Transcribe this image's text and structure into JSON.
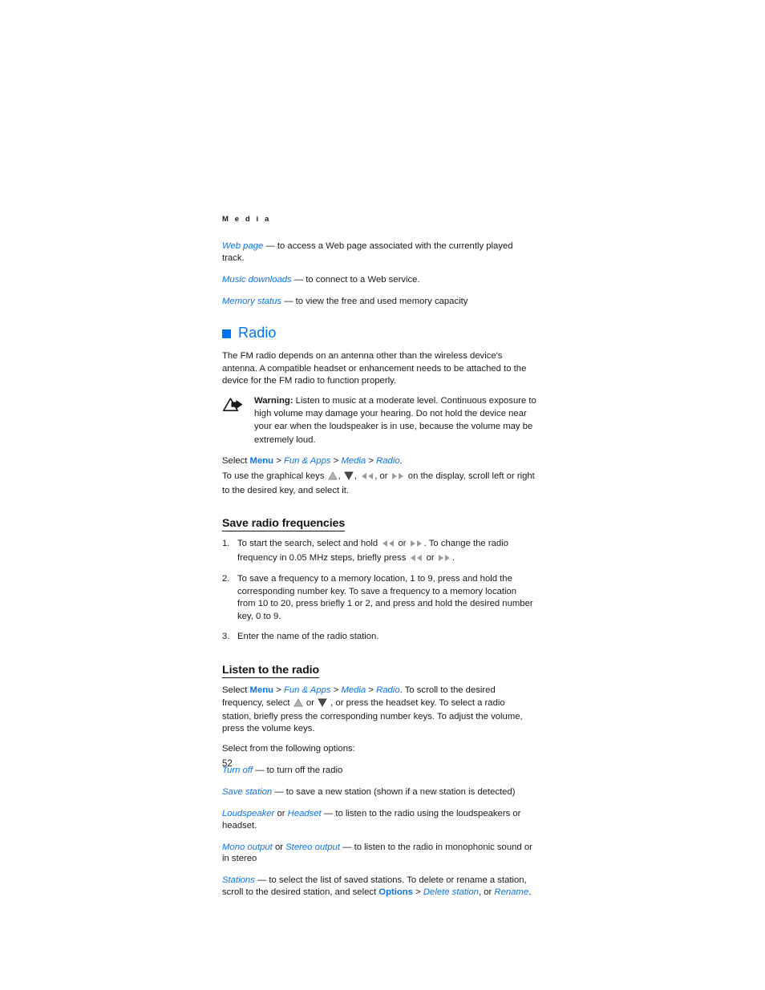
{
  "document": {
    "running_head": "M e d i a",
    "page_number": "52",
    "accent_blue": "#0073f5",
    "link_blue": "#0b72ee",
    "text_color": "#1a1a1a"
  },
  "media_options": [
    {
      "term": "Web page",
      "dash": "—",
      "description": "to access a Web page associated with the currently played track."
    },
    {
      "term": "Music downloads",
      "dash": "—",
      "description": "to connect to a Web service."
    },
    {
      "term": "Memory status",
      "dash": "—",
      "description": "to view the free and used memory capacity"
    }
  ],
  "radio_section": {
    "heading": "Radio",
    "intro": "The FM radio depends on an antenna other than the wireless device's antenna. A compatible headset or enhancement needs to be attached to the device for the FM radio to function properly.",
    "warning": {
      "label": "Warning:",
      "text": "Listen to music at a moderate level. Continuous exposure to high volume may damage your hearing. Do not hold the device near your ear when the loudspeaker is in use, because the volume may be extremely loud.",
      "icon": "warning-triangle-arrow-icon"
    },
    "select_path": {
      "lead": "Select",
      "items": [
        "Menu",
        "Fun & Apps",
        "Media",
        "Radio"
      ],
      "separator": ">",
      "trailing": "."
    },
    "graphical_keys_text": {
      "part1": "To use the graphical keys",
      "part2": ",",
      "part3": ",",
      "part4": ", or",
      "part5": "on the display, scroll left or right to the desired key, and select it.",
      "icons": [
        "scroll-up-icon",
        "scroll-down-icon",
        "rewind-icon",
        "fast-forward-icon"
      ]
    }
  },
  "save_frequencies": {
    "heading": "Save radio frequencies",
    "steps": [
      {
        "number": "1.",
        "part1": "To start the search, select and hold",
        "part2": "or",
        "part3": ". To change the radio frequency in 0.05 MHz steps, briefly press",
        "part4": "or",
        "part5": "."
      },
      {
        "number": "2.",
        "text": "To save a frequency to a memory location, 1 to 9, press and hold the corresponding number key. To save a frequency to a memory location from 10 to 20, press briefly 1 or 2, and press and hold the desired number key, 0 to 9."
      },
      {
        "number": "3.",
        "text": "Enter the name of the radio station."
      }
    ]
  },
  "listen_section": {
    "heading": "Listen to the radio",
    "select_path": {
      "lead": "Select",
      "items": [
        "Menu",
        "Fun & Apps",
        "Media",
        "Radio"
      ],
      "separator": ">"
    },
    "after_path": ". To scroll to the desired frequency, select",
    "mid1": "or",
    "mid2": ", or press the headset key. To select a radio station, briefly press the corresponding number keys. To adjust the volume, press the volume keys.",
    "options_intro": "Select from the following options:",
    "options": [
      {
        "term": "Turn off",
        "dash": "—",
        "description": "to turn off the radio"
      },
      {
        "term": "Save station",
        "dash": "—",
        "description": "to save a new station (shown if a new station is detected)"
      },
      {
        "term": "Loudspeaker",
        "conjunction": "or",
        "term2": "Headset",
        "dash": "—",
        "description": "to listen to the radio using the loudspeakers or headset."
      },
      {
        "term": "Mono output",
        "conjunction": "or",
        "term2": "Stereo output",
        "dash": "—",
        "description": "to listen to the radio in monophonic sound or in stereo"
      },
      {
        "term": "Stations",
        "dash": "—",
        "description_a": "to select the list of saved stations. To delete or rename a station, scroll to the desired station, and select",
        "bold_link": "Options",
        "separator": ">",
        "link_a": "Delete station",
        "conjunction": ", or",
        "link_b": "Rename",
        "trailing": "."
      }
    ]
  }
}
